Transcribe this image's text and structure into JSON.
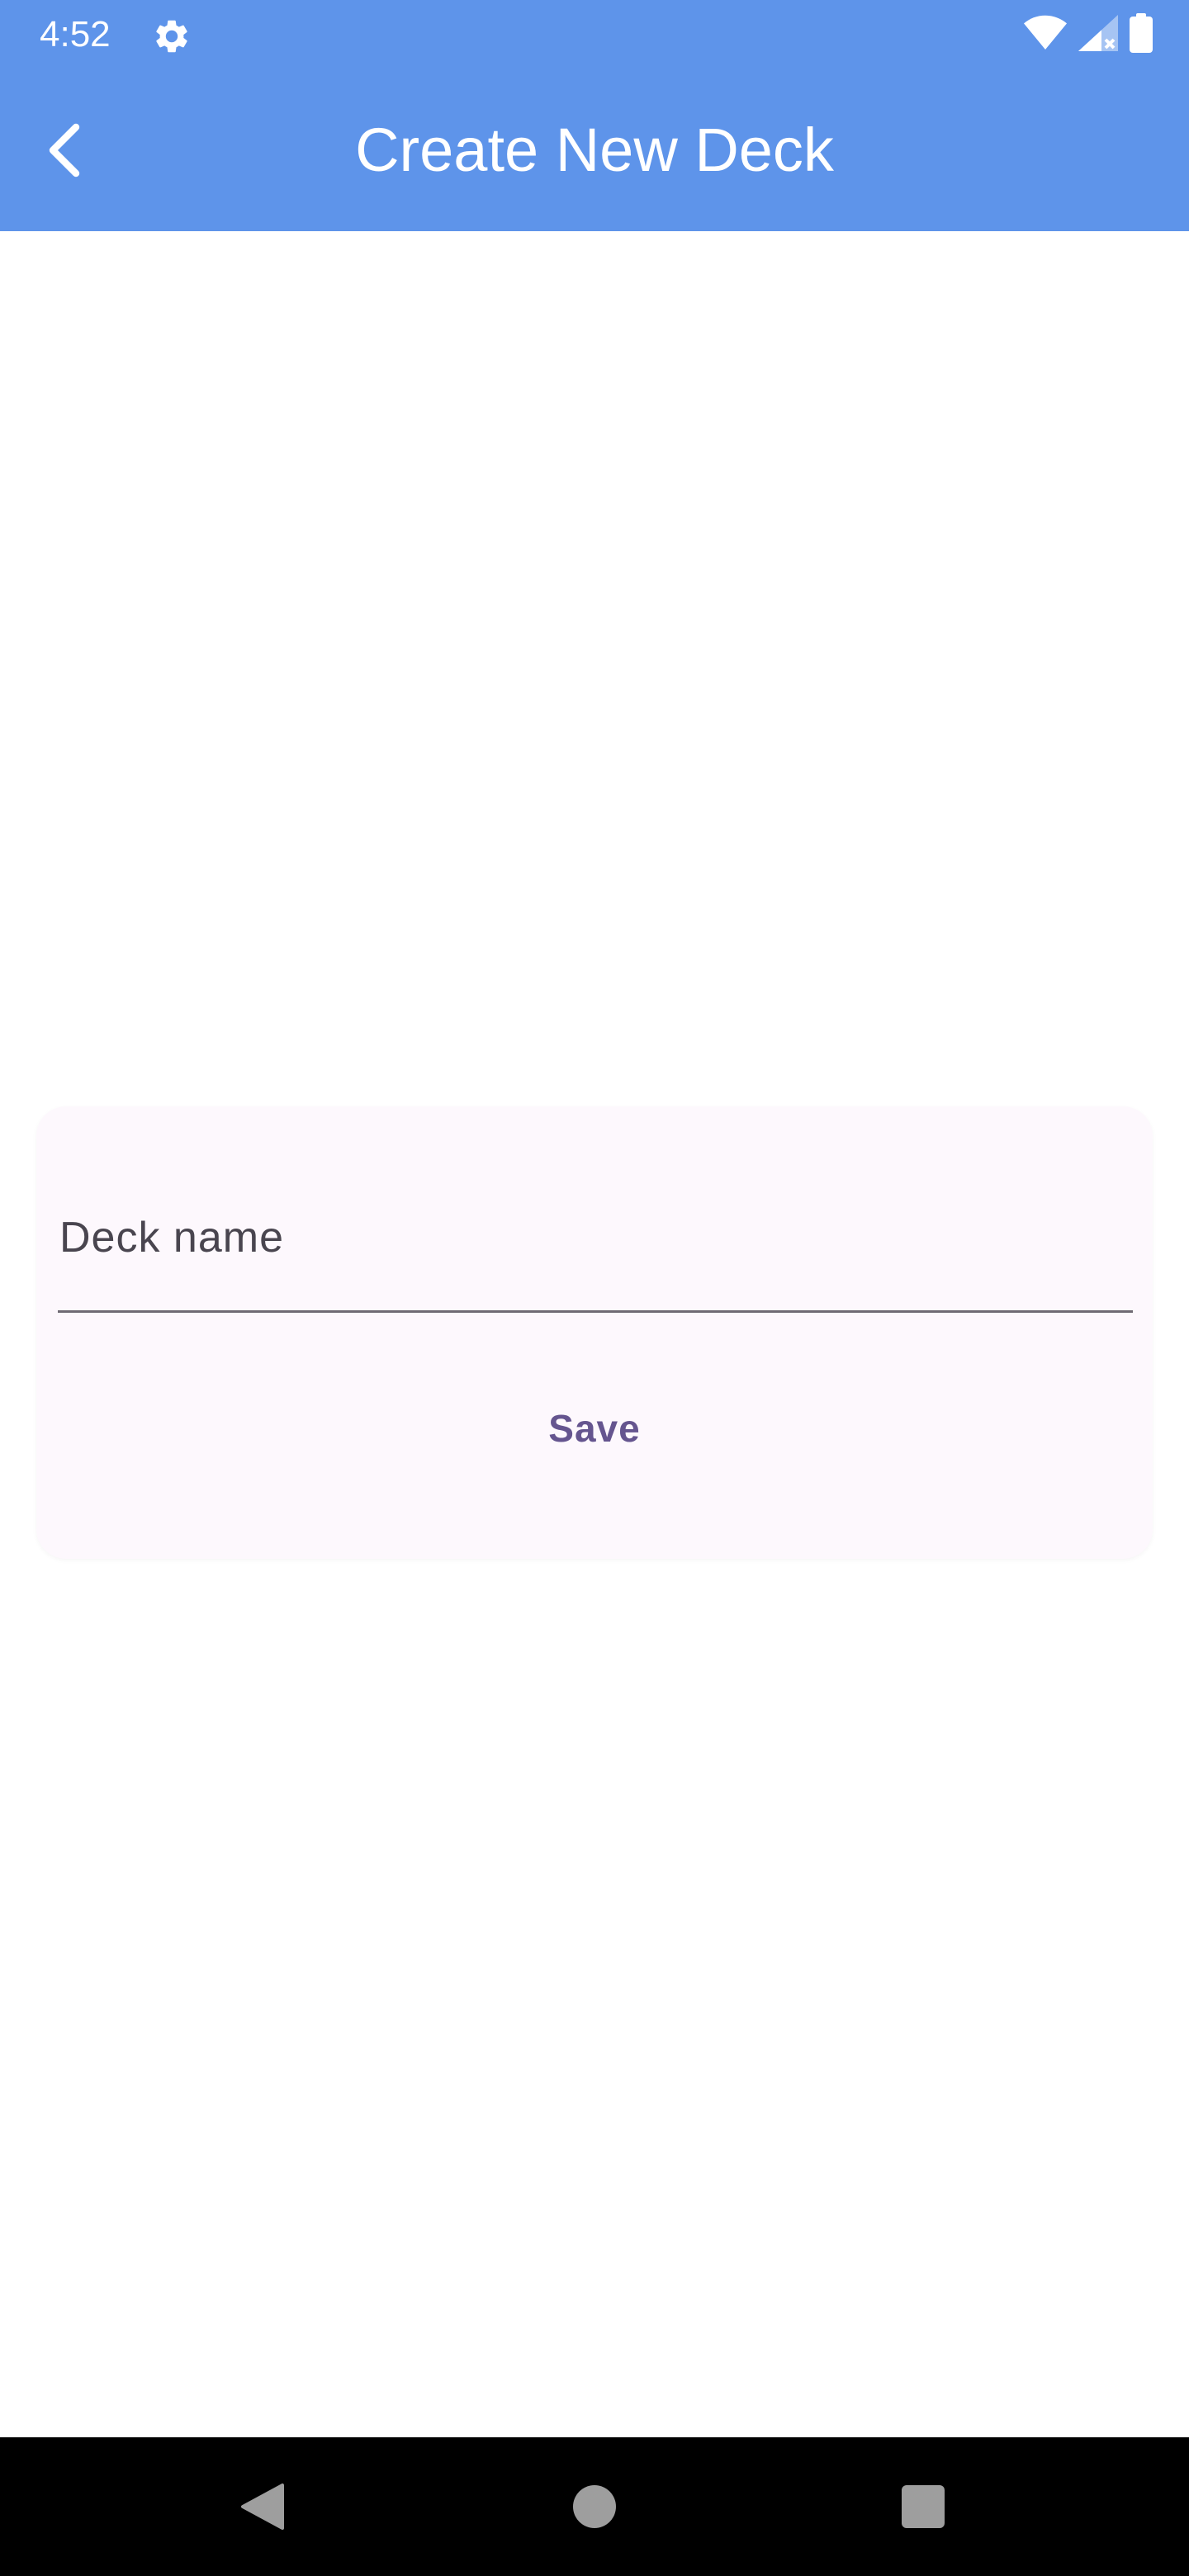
{
  "status_bar": {
    "time": "4:52",
    "background": "#5e94ea",
    "icons": [
      "gear-icon",
      "wifi-icon",
      "signal-icon",
      "battery-icon"
    ]
  },
  "app_bar": {
    "title": "Create New Deck",
    "back_icon": "chevron-left-icon",
    "background": "#5e94ea"
  },
  "form": {
    "deck_name_placeholder": "Deck name",
    "deck_name_value": "",
    "save_label": "Save",
    "accent_color": "#65558f",
    "card_background": "#fdf8fd"
  },
  "nav_bar": {
    "icons": [
      "back-triangle-icon",
      "home-circle-icon",
      "recents-square-icon"
    ]
  }
}
